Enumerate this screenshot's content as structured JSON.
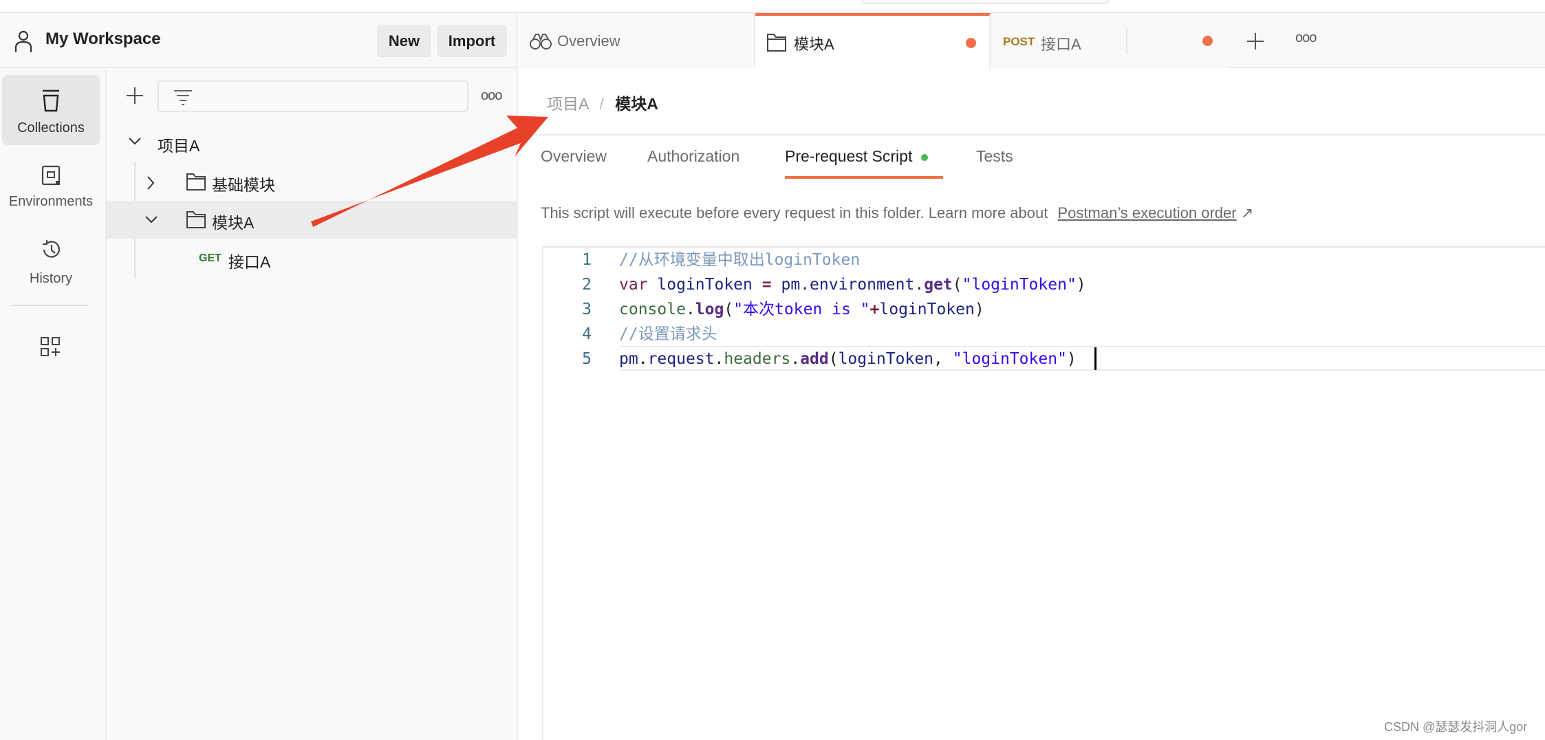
{
  "workspace": {
    "title": "My Workspace",
    "new_label": "New",
    "import_label": "Import"
  },
  "rail": [
    {
      "label": "Collections",
      "icon": "collections-icon",
      "active": true
    },
    {
      "label": "Environments",
      "icon": "environments-icon"
    },
    {
      "label": "History",
      "icon": "history-icon"
    },
    {
      "icon": "apps-icon"
    }
  ],
  "tree": {
    "root": "项目A",
    "items": [
      {
        "label": "基础模块",
        "expanded": false
      },
      {
        "label": "模块A",
        "expanded": true,
        "selected": true
      }
    ],
    "request": {
      "method": "GET",
      "label": "接口A"
    }
  },
  "tabs": [
    {
      "label": "Overview",
      "icon": "binoculars-icon"
    },
    {
      "label": "模块A",
      "icon": "folder-icon",
      "active": true,
      "unsaved": true
    },
    {
      "method": "POST",
      "label": "接口A",
      "unsaved": true
    }
  ],
  "breadcrumb": {
    "parent": "项目A",
    "separator": "/",
    "current": "模块A"
  },
  "subtabs": [
    {
      "label": "Overview"
    },
    {
      "label": "Authorization"
    },
    {
      "label": "Pre-request Script",
      "active": true,
      "indicator": true
    },
    {
      "label": "Tests"
    }
  ],
  "description": {
    "text": "This script will execute before every request in this folder. Learn more about",
    "link": "Postman’s execution order",
    "link_icon": "↗"
  },
  "code": [
    [
      [
        "comment",
        "//从环境变量中取出loginToken"
      ]
    ],
    [
      [
        "keyword",
        "var"
      ],
      [
        "punc",
        " "
      ],
      [
        "var",
        "loginToken"
      ],
      [
        "punc",
        " "
      ],
      [
        "op",
        "="
      ],
      [
        "punc",
        " "
      ],
      [
        "var",
        "pm"
      ],
      [
        "punc",
        "."
      ],
      [
        "var",
        "environment"
      ],
      [
        "punc",
        "."
      ],
      [
        "method",
        "get"
      ],
      [
        "punc",
        "("
      ],
      [
        "string",
        "\"loginToken\""
      ],
      [
        "punc",
        ")"
      ]
    ],
    [
      [
        "prop",
        "console"
      ],
      [
        "punc",
        "."
      ],
      [
        "method",
        "log"
      ],
      [
        "punc",
        "("
      ],
      [
        "string",
        "\"本次token is \""
      ],
      [
        "op",
        "+"
      ],
      [
        "var",
        "loginToken"
      ],
      [
        "punc",
        ")"
      ]
    ],
    [
      [
        "comment",
        "//设置请求头"
      ]
    ],
    [
      [
        "var",
        "pm"
      ],
      [
        "punc",
        "."
      ],
      [
        "var",
        "request"
      ],
      [
        "punc",
        "."
      ],
      [
        "prop",
        "headers"
      ],
      [
        "punc",
        "."
      ],
      [
        "method",
        "add"
      ],
      [
        "punc",
        "("
      ],
      [
        "var",
        "loginToken"
      ],
      [
        "punc",
        ", "
      ],
      [
        "string",
        "\"loginToken\""
      ],
      [
        "punc",
        ")"
      ]
    ]
  ],
  "line_numbers": [
    "1",
    "2",
    "3",
    "4",
    "5"
  ],
  "watermark": "CSDN @瑟瑟发抖洞人gor",
  "colors": {
    "accent": "#ef7147",
    "get": "#2f7d32",
    "post": "#a8791c",
    "indicator": "#49b85a",
    "annotation_arrow": "#e8412a"
  }
}
